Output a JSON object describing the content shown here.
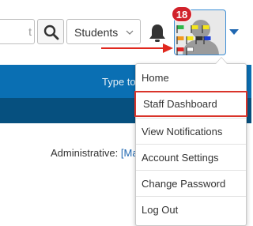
{
  "search": {
    "value_fragment": "t"
  },
  "filter_select": {
    "selected": "Students"
  },
  "notifications": {
    "count": "18"
  },
  "nav_bar": {
    "placeholder_fragment": "Type to"
  },
  "content": {
    "label": "Administrative:",
    "link_fragment": "[Mar"
  },
  "user_menu": {
    "items": [
      {
        "label": "Home"
      },
      {
        "label": "Staff Dashboard"
      },
      {
        "label": "View Notifications"
      },
      {
        "label": "Account Settings"
      },
      {
        "label": "Change Password"
      },
      {
        "label": "Log Out"
      }
    ]
  },
  "colors": {
    "primary_bar": "#0a6fb3",
    "secondary_bar": "#06507f",
    "badge": "#d1222b",
    "highlight_outline": "#d9342a"
  }
}
